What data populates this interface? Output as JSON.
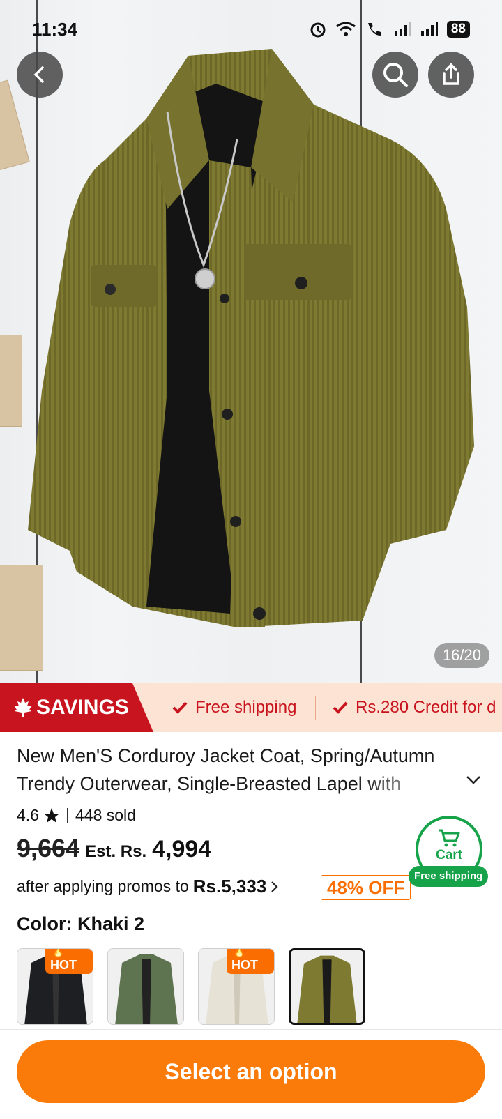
{
  "status_bar": {
    "time": "11:34",
    "battery": "88"
  },
  "gallery": {
    "counter": "16/20"
  },
  "promo_strip": {
    "badge": "SAVINGS",
    "perk_1": "Free shipping",
    "perk_2": "Rs.280 Credit for d"
  },
  "product": {
    "title": "New Men'S Corduroy Jacket Coat, Spring/Autumn Trendy Outerwear, Single-Breasted Lapel with",
    "rating": "4.6",
    "sold": "448 sold",
    "original_price": "9,664",
    "est_label": "Est. Rs.",
    "sale_price": "4,994",
    "promo_prefix": "after applying promos to",
    "promo_price": "Rs.5,333",
    "discount": "48% OFF"
  },
  "cart": {
    "label": "Cart",
    "shipping": "Free shipping"
  },
  "color": {
    "label": "Color: Khaki 2",
    "options": [
      {
        "hot": "HOT",
        "color": "#1e1f22"
      },
      {
        "hot": "",
        "color": "#5e7350"
      },
      {
        "hot": "HOT",
        "color": "#e6e2d6"
      },
      {
        "hot": "",
        "color": "#7f7a32",
        "selected": true
      }
    ]
  },
  "cta": {
    "label": "Select an option"
  },
  "colors": {
    "accent_orange": "#fa7a0a",
    "savings_red": "#c8141e",
    "cart_green": "#16a34a",
    "jacket": "#7f7a32"
  }
}
